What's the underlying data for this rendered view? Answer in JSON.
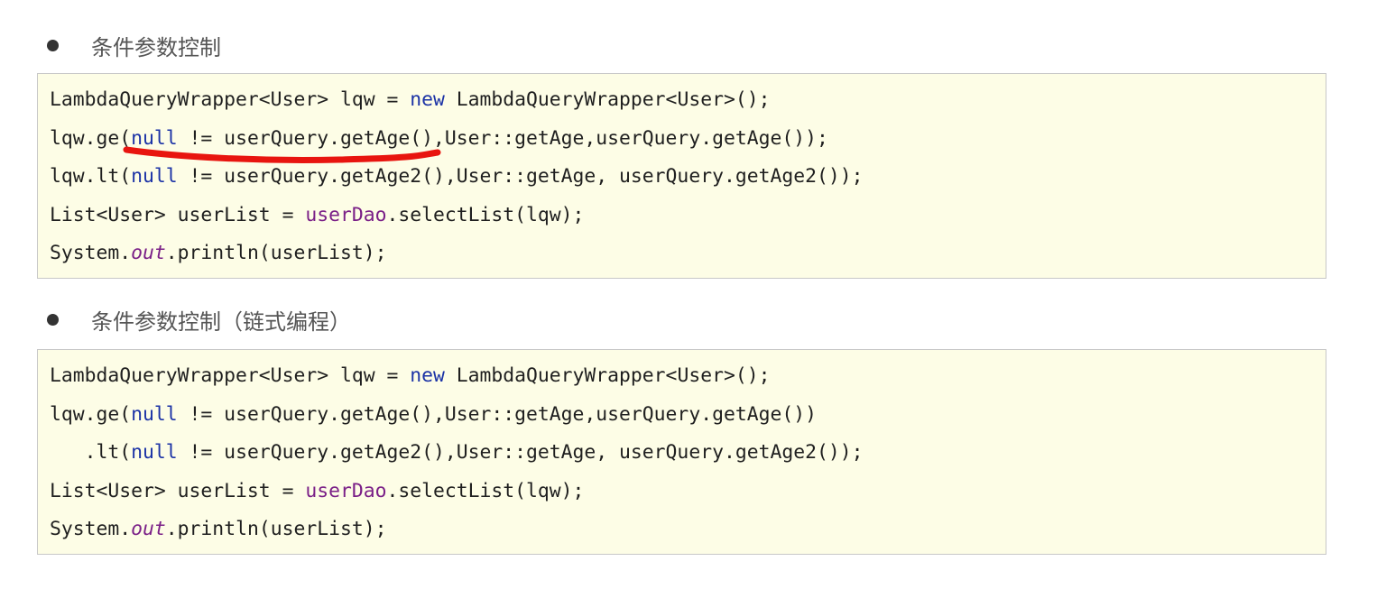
{
  "section1": {
    "heading": "条件参数控制",
    "lines": [
      [
        {
          "t": "LambdaQueryWrapper<User> lqw = ",
          "c": ""
        },
        {
          "t": "new",
          "c": "kw"
        },
        {
          "t": " LambdaQueryWrapper<User>();",
          "c": ""
        }
      ],
      [
        {
          "t": "lqw.ge(",
          "c": ""
        },
        {
          "t": "null",
          "c": "kw"
        },
        {
          "t": " != userQuery.getAge(),User::getAge,userQuery.getAge());",
          "c": ""
        }
      ],
      [
        {
          "t": "lqw.lt(",
          "c": ""
        },
        {
          "t": "null",
          "c": "kw"
        },
        {
          "t": " != userQuery.getAge2(),User::getAge, userQuery.getAge2());",
          "c": ""
        }
      ],
      [
        {
          "t": "List<User> userList = ",
          "c": ""
        },
        {
          "t": "userDao",
          "c": "field"
        },
        {
          "t": ".selectList(lqw);",
          "c": ""
        }
      ],
      [
        {
          "t": "System.",
          "c": ""
        },
        {
          "t": "out",
          "c": "static"
        },
        {
          "t": ".println(userList);",
          "c": ""
        }
      ]
    ]
  },
  "section2": {
    "heading": "条件参数控制（链式编程）",
    "lines": [
      [
        {
          "t": "LambdaQueryWrapper<User> lqw = ",
          "c": ""
        },
        {
          "t": "new",
          "c": "kw"
        },
        {
          "t": " LambdaQueryWrapper<User>();",
          "c": ""
        }
      ],
      [
        {
          "t": "lqw.ge(",
          "c": ""
        },
        {
          "t": "null",
          "c": "kw"
        },
        {
          "t": " != userQuery.getAge(),User::getAge,userQuery.getAge())",
          "c": ""
        }
      ],
      [
        {
          "t": "   .lt(",
          "c": ""
        },
        {
          "t": "null",
          "c": "kw"
        },
        {
          "t": " != userQuery.getAge2(),User::getAge, userQuery.getAge2());",
          "c": ""
        }
      ],
      [
        {
          "t": "List<User> userList = ",
          "c": ""
        },
        {
          "t": "userDao",
          "c": "field"
        },
        {
          "t": ".selectList(lqw);",
          "c": ""
        }
      ],
      [
        {
          "t": "System.",
          "c": ""
        },
        {
          "t": "out",
          "c": "static"
        },
        {
          "t": ".println(userList);",
          "c": ""
        }
      ]
    ]
  },
  "colors": {
    "code_background": "#fdfde6",
    "keyword": "#1c33a6",
    "field": "#7a1f87",
    "annotation_mark": "#e8150f"
  }
}
